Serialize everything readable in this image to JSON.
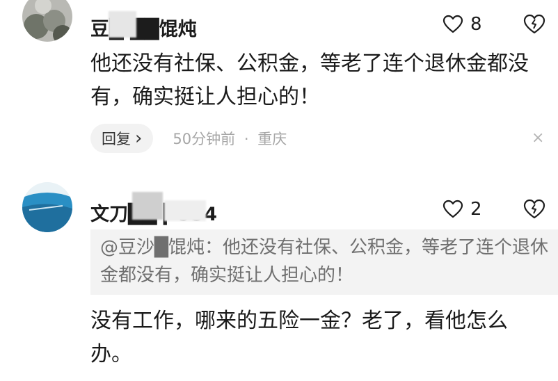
{
  "comments": [
    {
      "username": "豆█ ██馄炖",
      "like_count": "8",
      "text": "他还没有社保、公积金，等老了连个退休金都没有，确实挺让人担心的！",
      "reply_label": "回复",
      "reply_chevron": "›",
      "time": "50分钟前",
      "separator": "·",
      "location": "重庆",
      "close_glyph": "×"
    },
    {
      "username": "文刀██   ▎934",
      "like_count": "2",
      "quote": "@豆沙█馄炖：他还没有社保、公积金，等老了连个退休金都没有，确实挺让人担心的！",
      "text": "没有工作，哪来的五险一金？老了，看他怎么办。"
    }
  ],
  "icons": {
    "like": "heart-icon",
    "dislike": "broken-heart-icon",
    "close": "close-icon"
  },
  "colors": {
    "text": "#1a1a1a",
    "meta": "#a6a6a6",
    "quote_bg": "#f3f3f3",
    "reply_bg": "#f2f2f2"
  }
}
